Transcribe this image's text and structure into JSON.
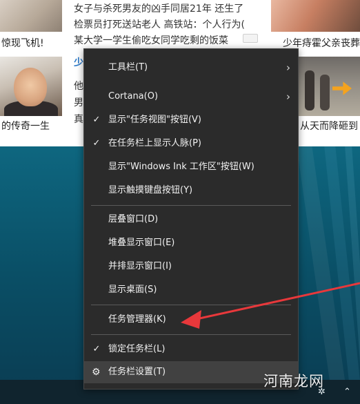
{
  "news": {
    "headline_1": "女子与杀死男友的凶手同居21年 还生了",
    "headline_2": "检票员打死送站老人 高铁站：个人行为(",
    "headline_3": "某大学一学生偷吃女同学吃剩的饭菜",
    "caption_tl": "惊现飞机!",
    "caption_tr": "少年痔霍父亲丧葬",
    "blue_fragment": "少",
    "side_1": "他",
    "side_2": "男",
    "side_3": "真",
    "caption_ml": "的传奇一生",
    "caption_mr": "从天而降砸到"
  },
  "menu": {
    "items": [
      {
        "label": "工具栏(T)",
        "checked": false,
        "submenu": true
      },
      {
        "label": "Cortana(O)",
        "checked": false,
        "submenu": true
      },
      {
        "label": "显示\"任务视图\"按钮(V)",
        "checked": true,
        "submenu": false
      },
      {
        "label": "在任务栏上显示人脉(P)",
        "checked": true,
        "submenu": false
      },
      {
        "label": "显示\"Windows Ink 工作区\"按钮(W)",
        "checked": false,
        "submenu": false
      },
      {
        "label": "显示触摸键盘按钮(Y)",
        "checked": false,
        "submenu": false
      },
      {
        "label": "层叠窗口(D)",
        "checked": false,
        "submenu": false
      },
      {
        "label": "堆叠显示窗口(E)",
        "checked": false,
        "submenu": false
      },
      {
        "label": "并排显示窗口(I)",
        "checked": false,
        "submenu": false
      },
      {
        "label": "显示桌面(S)",
        "checked": false,
        "submenu": false
      },
      {
        "label": "任务管理器(K)",
        "checked": false,
        "submenu": false
      },
      {
        "label": "锁定任务栏(L)",
        "checked": true,
        "submenu": false
      },
      {
        "label": "任务栏设置(T)",
        "checked": false,
        "submenu": false,
        "icon": "gear-icon"
      }
    ],
    "check_glyph": "✓",
    "submenu_glyph": "›",
    "gear_glyph": "⚙"
  },
  "watermark": "河南龙网",
  "annotation": {
    "color": "#e8383b"
  }
}
